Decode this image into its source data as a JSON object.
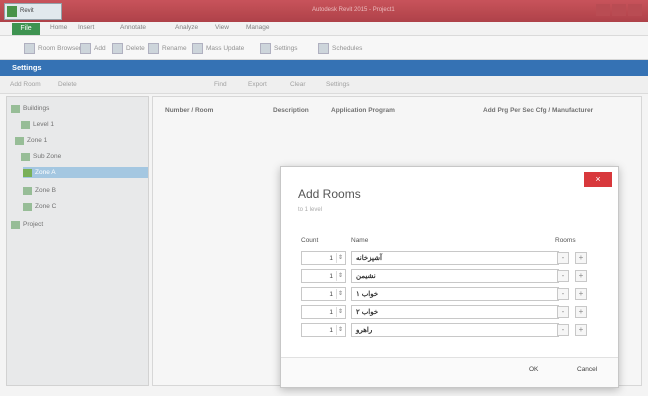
{
  "titlebar": {
    "title": "Autodesk Revit 2015 - Project1",
    "app_name": "Revit"
  },
  "menu": {
    "file": "File",
    "items": [
      "Home",
      "Insert",
      "Annotate",
      "Analyze",
      "View",
      "Manage"
    ]
  },
  "ribbon": {
    "items": [
      "Room Browser",
      "Add",
      "Delete",
      "Rename",
      "Mass Update",
      "Settings",
      "Schedules"
    ]
  },
  "panel": {
    "title": "Settings"
  },
  "subbar": {
    "items": [
      "Add Room",
      "Delete",
      "Find",
      "Export",
      "Clear",
      "Settings"
    ]
  },
  "tree": {
    "items": [
      {
        "label": "Buildings",
        "selected": false
      },
      {
        "label": "Level 1",
        "selected": false
      },
      {
        "label": "Zone 1",
        "selected": false
      },
      {
        "label": "Sub Zone",
        "selected": false
      },
      {
        "label": "Zone A",
        "selected": true
      },
      {
        "label": "Zone B",
        "selected": false
      },
      {
        "label": "Zone C",
        "selected": false
      },
      {
        "label": "Project",
        "selected": false
      }
    ]
  },
  "table": {
    "columns": [
      "Number / Room",
      "Description",
      "Application Program",
      "Add Prg Per Sec Cfg / Manufacturer"
    ]
  },
  "dialog": {
    "title": "Add Rooms",
    "subtitle": "to 1 level",
    "close": "×",
    "headers": {
      "count": "Count",
      "name": "Name",
      "rooms": "Rooms"
    },
    "rows": [
      {
        "count": "1",
        "name": "آشپزخانه"
      },
      {
        "count": "1",
        "name": "نشیمن"
      },
      {
        "count": "1",
        "name": "خواب ۱"
      },
      {
        "count": "1",
        "name": "خواب ۲"
      },
      {
        "count": "1",
        "name": "راهرو"
      }
    ],
    "minus": "-",
    "plus": "+",
    "ok": "OK",
    "cancel": "Cancel"
  }
}
